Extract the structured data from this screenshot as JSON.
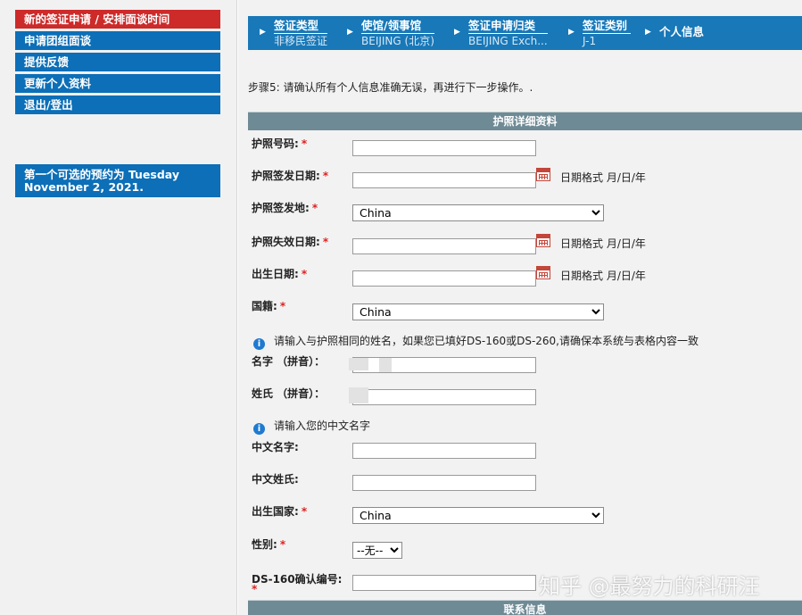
{
  "sidebar": {
    "items": [
      {
        "label": "新的签证申请 / 安排面谈时间",
        "active": true
      },
      {
        "label": "申请团组面谈",
        "active": false
      },
      {
        "label": "提供反馈",
        "active": false
      },
      {
        "label": "更新个人资料",
        "active": false
      },
      {
        "label": "退出/登出",
        "active": false
      }
    ],
    "appointment_notice": "第一个可选的预约为 Tuesday November 2, 2021."
  },
  "breadcrumb": {
    "steps": [
      {
        "title": "签证类型",
        "value": "非移民签证"
      },
      {
        "title": "使馆/领事馆",
        "value": "BEIJING (北京)"
      },
      {
        "title": "签证申请归类",
        "value": "BEIJING Exch..."
      },
      {
        "title": "签证类别",
        "value": "J-1"
      },
      {
        "title": "个人信息",
        "value": ""
      }
    ]
  },
  "step_instruction": "步骤5: 请确认所有个人信息准确无误，再进行下一步操作。.",
  "passport_section": {
    "heading": "护照详细资料",
    "fields": {
      "passport_number": {
        "label": "护照号码:",
        "value": ""
      },
      "issue_date": {
        "label": "护照签发日期:",
        "value": "",
        "format_hint": "日期格式 月/日/年"
      },
      "issue_place": {
        "label": "护照签发地:",
        "value": "China"
      },
      "expiry_date": {
        "label": "护照失效日期:",
        "value": "",
        "format_hint": "日期格式 月/日/年"
      },
      "birth_date": {
        "label": "出生日期:",
        "value": "",
        "format_hint": "日期格式 月/日/年"
      },
      "nationality": {
        "label": "国籍:",
        "value": "China"
      }
    },
    "name_info": "请输入与护照相同的姓名，如果您已填好DS-160或DS-260,请确保本系统与表格内容一致",
    "given_name_pinyin": {
      "label": "名字 （拼音）：",
      "value": ""
    },
    "surname_pinyin": {
      "label": "姓氏 （拼音）：",
      "value": ""
    },
    "chinese_name_info": "请输入您的中文名字",
    "chinese_given_name": {
      "label": "中文名字:",
      "value": ""
    },
    "chinese_surname": {
      "label": "中文姓氏:",
      "value": ""
    },
    "birth_country": {
      "label": "出生国家:",
      "value": "China"
    },
    "gender": {
      "label": "性别:",
      "value": "--无--"
    },
    "ds160": {
      "label": "DS-160确认编号:",
      "value": ""
    }
  },
  "contact_section": {
    "heading": "联系信息"
  },
  "required_mark": "*",
  "info_icon_glyph": "i",
  "watermark": "知乎 @最努力的科研汪",
  "colors": {
    "nav_blue": "#0c6fb7",
    "nav_active_red": "#cd2a2a",
    "section_head": "#6e8a95",
    "breadcrumb_bg": "#1878b8",
    "required": "#dd2222"
  }
}
